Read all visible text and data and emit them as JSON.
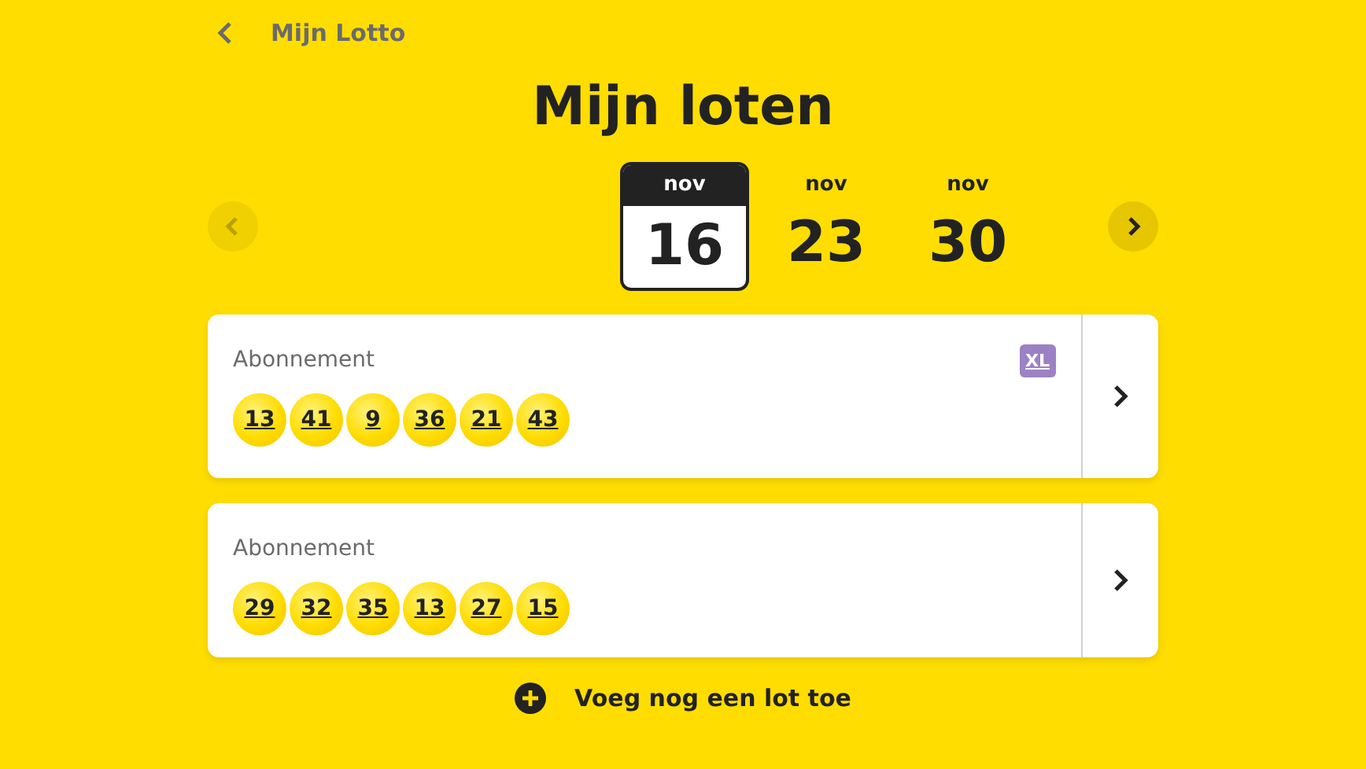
{
  "header": {
    "back_label": "Mijn Lotto"
  },
  "title": "Mijn loten",
  "date_nav": {
    "prev_disabled": true,
    "next_disabled": false,
    "dates": [
      {
        "month": "nov",
        "day": "16",
        "selected": true
      },
      {
        "month": "nov",
        "day": "23",
        "selected": false
      },
      {
        "month": "nov",
        "day": "30",
        "selected": false
      }
    ]
  },
  "tickets": [
    {
      "type": "Abonnement",
      "badge": "XL",
      "numbers": [
        "13",
        "41",
        "9",
        "36",
        "21",
        "43"
      ]
    },
    {
      "type": "Abonnement",
      "numbers": [
        "29",
        "32",
        "35",
        "13",
        "27",
        "15"
      ]
    }
  ],
  "add_button": "Voeg nog een lot toe"
}
